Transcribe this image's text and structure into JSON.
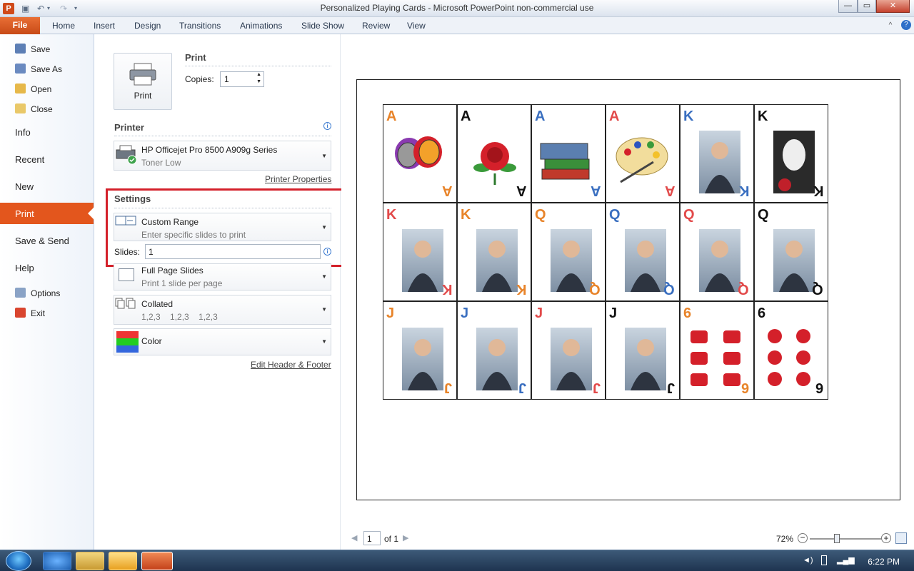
{
  "window": {
    "app_icon_letter": "P",
    "title": "Personalized Playing Cards  -  Microsoft PowerPoint non-commercial use",
    "minimize": "—",
    "maximize": "▭",
    "close": "✕"
  },
  "ribbon": {
    "file_tab": "File",
    "tabs": [
      "Home",
      "Insert",
      "Design",
      "Transitions",
      "Animations",
      "Slide Show",
      "Review",
      "View"
    ],
    "help": "?",
    "collapse": "^"
  },
  "nav": {
    "save": "Save",
    "save_as": "Save As",
    "open": "Open",
    "close": "Close",
    "info": "Info",
    "recent": "Recent",
    "new": "New",
    "print": "Print",
    "save_send": "Save & Send",
    "help": "Help",
    "options": "Options",
    "exit": "Exit"
  },
  "print_section": {
    "heading": "Print",
    "button_label": "Print",
    "copies_label": "Copies:",
    "copies_value": "1"
  },
  "printer": {
    "heading": "Printer",
    "name": "HP Officejet Pro 8500 A909g Series",
    "status": "Toner Low",
    "properties_link": "Printer Properties"
  },
  "settings": {
    "heading": "Settings",
    "range_title": "Custom Range",
    "range_desc": "Enter specific slides to print",
    "slides_label": "Slides:",
    "slides_value": "1",
    "layout_title": "Full Page Slides",
    "layout_desc": "Print 1 slide per page",
    "collate_title": "Collated",
    "collate_desc": "1,2,3    1,2,3    1,2,3",
    "color_title": "Color",
    "edit_header_footer": "Edit Header & Footer"
  },
  "preview": {
    "cards": [
      {
        "rank": "A",
        "color": "#e8842a",
        "picture": "theater-masks"
      },
      {
        "rank": "A",
        "color": "#111111",
        "picture": "rose"
      },
      {
        "rank": "A",
        "color": "#3a6fc0",
        "picture": "books"
      },
      {
        "rank": "A",
        "color": "#e24a4a",
        "picture": "paint-palette"
      },
      {
        "rank": "K",
        "color": "#3a6fc0",
        "picture": "portrait"
      },
      {
        "rank": "K",
        "color": "#111111",
        "picture": "mask-portrait"
      },
      {
        "rank": "K",
        "color": "#e24a4a",
        "picture": "portrait"
      },
      {
        "rank": "K",
        "color": "#e8842a",
        "picture": "portrait"
      },
      {
        "rank": "Q",
        "color": "#e8842a",
        "picture": "portrait"
      },
      {
        "rank": "Q",
        "color": "#3a6fc0",
        "picture": "portrait"
      },
      {
        "rank": "Q",
        "color": "#e24a4a",
        "picture": "portrait"
      },
      {
        "rank": "Q",
        "color": "#111111",
        "picture": "portrait"
      },
      {
        "rank": "J",
        "color": "#e8842a",
        "picture": "portrait"
      },
      {
        "rank": "J",
        "color": "#3a6fc0",
        "picture": "portrait"
      },
      {
        "rank": "J",
        "color": "#e24a4a",
        "picture": "portrait"
      },
      {
        "rank": "J",
        "color": "#111111",
        "picture": "portrait"
      },
      {
        "rank": "6",
        "color": "#e8842a",
        "picture": "six-masks"
      },
      {
        "rank": "6",
        "color": "#111111",
        "picture": "six-roses"
      }
    ]
  },
  "status_bar": {
    "page_value": "1",
    "page_of": "of 1",
    "zoom": "72%"
  },
  "taskbar": {
    "clock": "6:22 PM"
  }
}
